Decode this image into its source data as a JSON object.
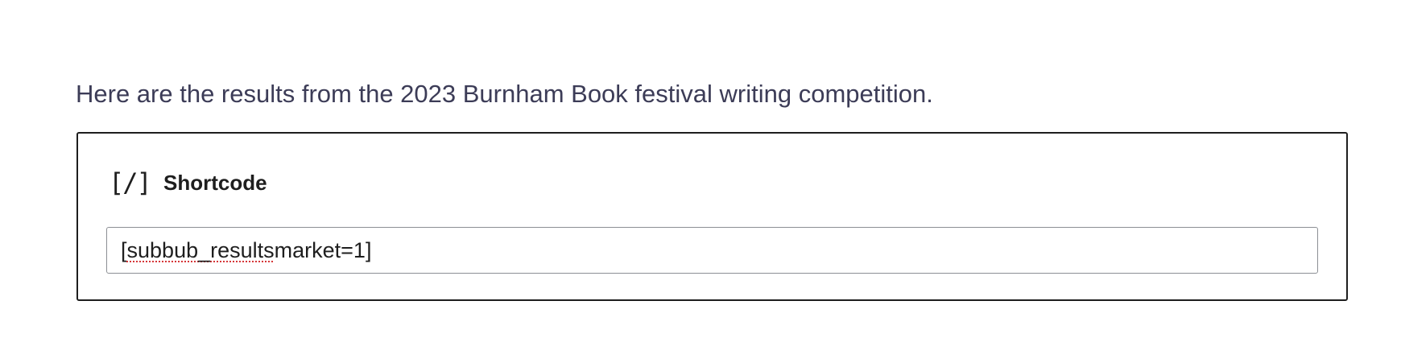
{
  "content": {
    "intro_text": "Here are the results from the 2023 Burnham Book festival writing competition."
  },
  "shortcode_block": {
    "icon": "shortcode-icon",
    "icon_glyph": "[/]",
    "label": "Shortcode",
    "value_prefix": "[",
    "value_misspelled": "subbub_results",
    "value_suffix": " market=1]"
  }
}
